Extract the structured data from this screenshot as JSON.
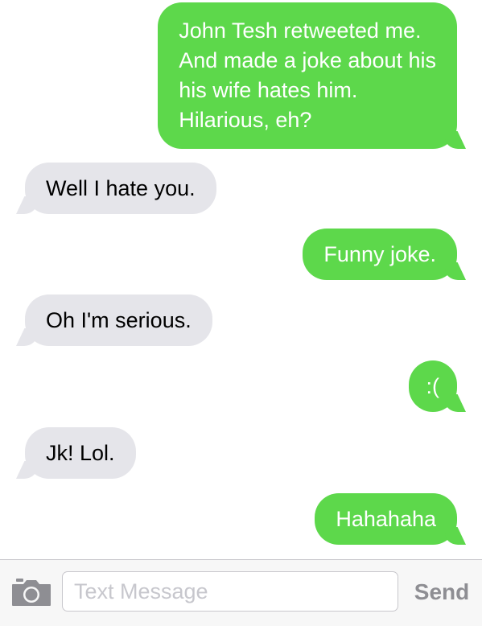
{
  "conversation": {
    "messages": [
      {
        "direction": "outgoing",
        "lines": [
          "John Tesh retweeted me.",
          "And made a joke about his",
          "his wife hates him.",
          "Hilarious, eh?"
        ]
      },
      {
        "direction": "incoming",
        "lines": [
          "Well I hate you."
        ]
      },
      {
        "direction": "outgoing",
        "lines": [
          "Funny joke."
        ]
      },
      {
        "direction": "incoming",
        "lines": [
          "Oh I'm serious."
        ]
      },
      {
        "direction": "outgoing",
        "lines": [
          ":("
        ]
      },
      {
        "direction": "incoming",
        "lines": [
          "Jk! Lol."
        ]
      },
      {
        "direction": "outgoing",
        "lines": [
          "Hahahaha"
        ]
      }
    ]
  },
  "composer": {
    "camera_icon": "camera-icon",
    "placeholder": "Text Message",
    "value": "",
    "send_label": "Send"
  },
  "colors": {
    "outgoing_bubble": "#5dd84b",
    "incoming_bubble": "#e5e5ea",
    "send_disabled": "#8e8e93"
  }
}
